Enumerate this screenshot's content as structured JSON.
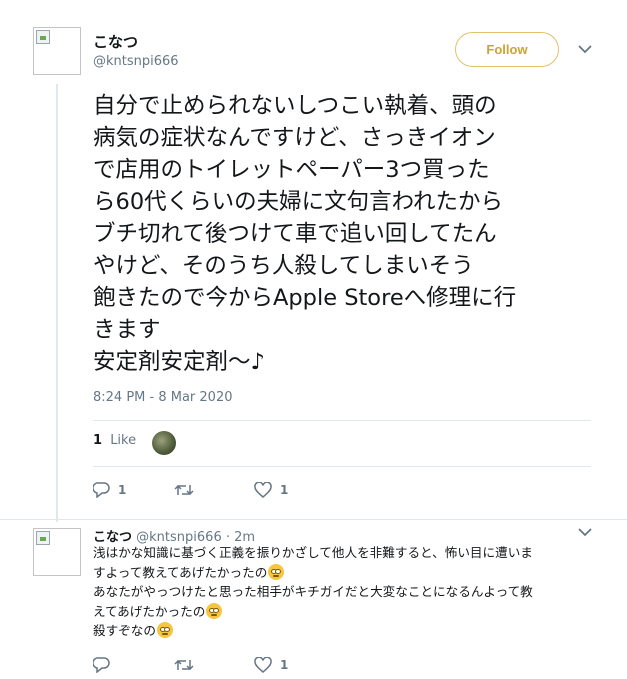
{
  "tweet": {
    "author_name": "こなつ",
    "author_handle": "@kntsnpi666",
    "follow_label": "Follow",
    "lines": [
      "自分で止められないしつこい執着、頭の",
      "病気の症状なんですけど、さっきイオン",
      "で店用のトイレットペーパー3つ買った",
      "ら60代くらいの夫婦に文句言われたから",
      "ブチ切れて後つけて車で追い回してたん",
      "やけど、そのうち人殺してしまいそう",
      "飽きたので今からApple Storeへ修理に行",
      "きます",
      "安定剤安定剤〜♪"
    ],
    "timestamp": "8:24 PM - 8 Mar 2020",
    "likes_count": "1",
    "likes_label": "Like",
    "actions": {
      "reply_count": "1",
      "retweet_count": "",
      "like_count": "1"
    }
  },
  "reply": {
    "author_name": "こなつ",
    "author_handle": "@kntsnpi666",
    "time_sep": " · ",
    "time": "2m",
    "lines": [
      {
        "text": "浅はかな知識に基づく正義を振りかざして他人を非難すると、怖い目に遭いま",
        "emoji": false
      },
      {
        "text": "すよって教えてあげたかったの",
        "emoji": true
      },
      {
        "text": "あなたがやっつけたと思った相手がキチガイだと大変なことになるんよって教",
        "emoji": false
      },
      {
        "text": "えてあげたかったの",
        "emoji": true
      },
      {
        "text": "殺すぞなの",
        "emoji": true
      }
    ],
    "actions": {
      "reply_count": "",
      "retweet_count": "",
      "like_count": "1"
    }
  },
  "icons": {
    "reply": "reply-icon",
    "retweet": "retweet-icon",
    "like": "heart-icon",
    "more": "chevron-down-icon",
    "emoji": "rolling-eyes-emoji"
  },
  "colors": {
    "text": "#14171a",
    "secondary": "#657786",
    "divider": "#e1e8ed",
    "follow_border": "#e1c16a",
    "follow_text": "#c9a43a"
  }
}
